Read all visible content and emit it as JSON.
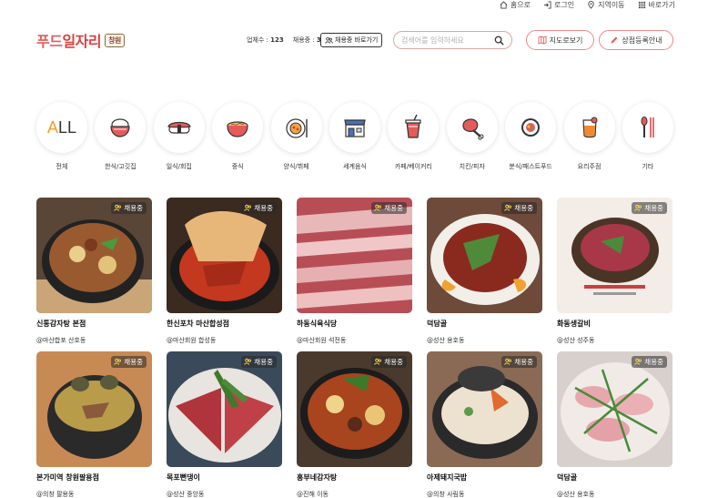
{
  "top_links": [
    {
      "label": "홈으로",
      "icon": "home-icon"
    },
    {
      "label": "로그인",
      "icon": "login-icon"
    },
    {
      "label": "지역이동",
      "icon": "location-pin-icon"
    },
    {
      "label": "바로가기",
      "icon": "grid-icon"
    }
  ],
  "header": {
    "logo_part1": "푸드",
    "logo_part2": "일자리",
    "region": "창원",
    "stats_company_label": "업체수 :",
    "stats_company_value": "123",
    "stats_hiring_label": "채용중 :",
    "stats_hiring_value": "30",
    "hiring_shortcut": "채용중 바로가기",
    "search_placeholder": "검색어를 입력하세요",
    "map_view": "지도로보기",
    "register_store": "상점등록안내"
  },
  "categories": [
    {
      "label": "전체",
      "icon": "all-icon"
    },
    {
      "label": "한식/고깃집",
      "icon": "rice-bowl-icon"
    },
    {
      "label": "일식/회집",
      "icon": "sushi-icon"
    },
    {
      "label": "중식",
      "icon": "noodle-bowl-icon"
    },
    {
      "label": "양식/뷔페",
      "icon": "pasta-plate-icon"
    },
    {
      "label": "세계음식",
      "icon": "store-icon"
    },
    {
      "label": "카페/베이커리",
      "icon": "drink-cup-icon"
    },
    {
      "label": "치킨/피자",
      "icon": "chicken-leg-icon"
    },
    {
      "label": "분식/패스트푸드",
      "icon": "kimbap-icon"
    },
    {
      "label": "요리주점",
      "icon": "cocktail-icon"
    },
    {
      "label": "기타",
      "icon": "spoon-chopsticks-icon"
    }
  ],
  "badge_label": "채용중",
  "restaurants": [
    {
      "name": "신통감자탕 본점",
      "location": "@마산합포 산호동"
    },
    {
      "name": "한신포차 마산합성점",
      "location": "@마산회원 합성동"
    },
    {
      "name": "하동식육식당",
      "location": "@마산회원 석전동"
    },
    {
      "name": "덕담골",
      "location": "@성산 용호동"
    },
    {
      "name": "화동생갈비",
      "location": "@성산 성주동"
    },
    {
      "name": "본가미역 창원팔용점",
      "location": "@의창 팔용동"
    },
    {
      "name": "목포뻔댕이",
      "location": "@성산 중앙동"
    },
    {
      "name": "홍부네감자탕",
      "location": "@진해 이동"
    },
    {
      "name": "아제돼지국밥",
      "location": "@의창 사림동"
    },
    {
      "name": "덕담골",
      "location": "@성산 용호동"
    }
  ],
  "colors": {
    "brand": "#e05d5d",
    "accent_border": "#ee8888"
  }
}
